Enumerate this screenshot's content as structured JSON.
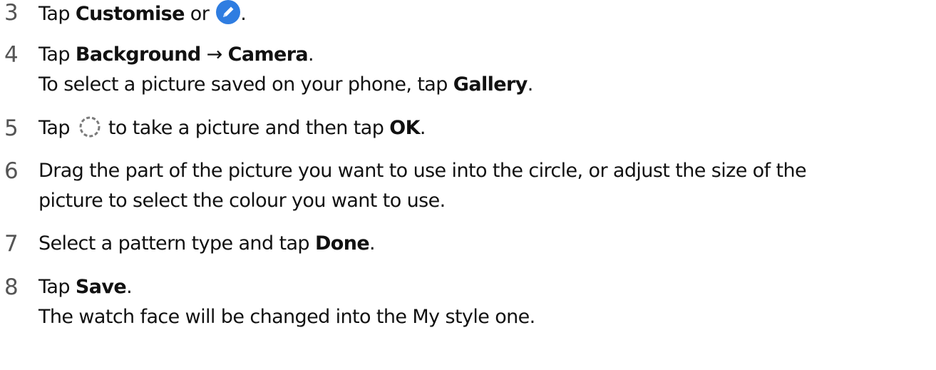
{
  "steps": [
    {
      "number": "3",
      "before": "Tap ",
      "bold1": "Customise",
      "mid": " or ",
      "icon": "pencil-edit-icon",
      "after": "."
    },
    {
      "number": "4",
      "before": "Tap ",
      "bold1": "Background",
      "arrow": " → ",
      "bold2": "Camera",
      "after": ".",
      "sub_before": "To select a picture saved on your phone, tap ",
      "sub_bold": "Gallery",
      "sub_after": "."
    },
    {
      "number": "5",
      "before": "Tap ",
      "icon": "camera-shutter-icon",
      "mid": " to take a picture and then tap ",
      "bold1": "OK",
      "after": "."
    },
    {
      "number": "6",
      "line1": "Drag the part of the picture you want to use into the circle, or adjust the size of the",
      "line2": "picture to select the colour you want to use."
    },
    {
      "number": "7",
      "before": "Select a pattern type and tap ",
      "bold1": "Done",
      "after": "."
    },
    {
      "number": "8",
      "before": "Tap ",
      "bold1": "Save",
      "after": ".",
      "sub_text": "The watch face will be changed into the My style one."
    }
  ],
  "colors": {
    "text": "#111111",
    "step_number": "#555555",
    "icon_blue": "#2f7de1"
  }
}
